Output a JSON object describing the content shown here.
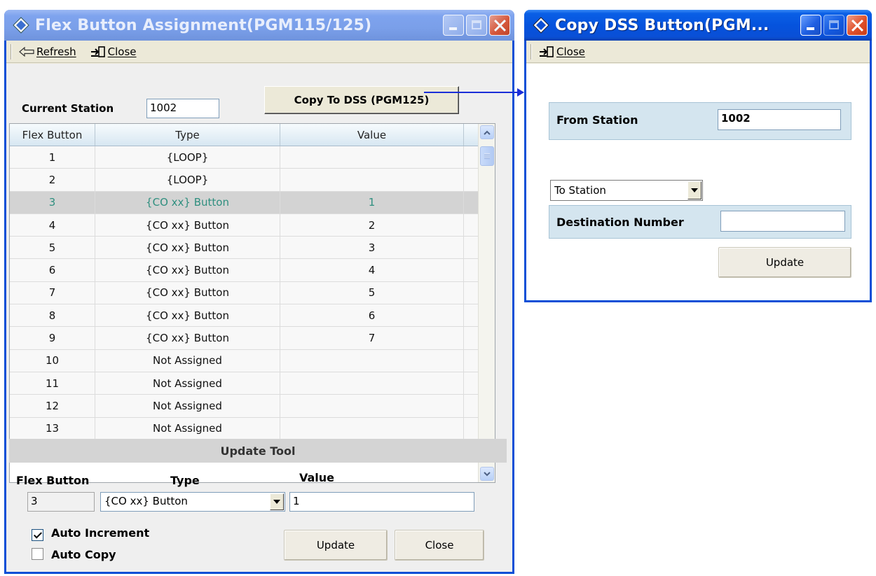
{
  "flex_window": {
    "title": "Flex Button Assignment(PGM115/125)",
    "toolbar": {
      "refresh_label": "Refresh",
      "close_label": "Close"
    },
    "current_station_label": "Current Station",
    "current_station_value": "1002",
    "copy_button_label": "Copy To DSS (PGM125)",
    "grid": {
      "headers": [
        "Flex Button",
        "Type",
        "Value"
      ],
      "rows": [
        {
          "flex": "1",
          "type": "{LOOP}",
          "value": ""
        },
        {
          "flex": "2",
          "type": "{LOOP}",
          "value": ""
        },
        {
          "flex": "3",
          "type": "{CO xx} Button",
          "value": "1"
        },
        {
          "flex": "4",
          "type": "{CO xx} Button",
          "value": "2"
        },
        {
          "flex": "5",
          "type": "{CO xx} Button",
          "value": "3"
        },
        {
          "flex": "6",
          "type": "{CO xx} Button",
          "value": "4"
        },
        {
          "flex": "7",
          "type": "{CO xx} Button",
          "value": "5"
        },
        {
          "flex": "8",
          "type": "{CO xx} Button",
          "value": "6"
        },
        {
          "flex": "9",
          "type": "{CO xx} Button",
          "value": "7"
        },
        {
          "flex": "10",
          "type": "Not Assigned",
          "value": ""
        },
        {
          "flex": "11",
          "type": "Not Assigned",
          "value": ""
        },
        {
          "flex": "12",
          "type": "Not Assigned",
          "value": ""
        },
        {
          "flex": "13",
          "type": "Not Assigned",
          "value": ""
        }
      ],
      "selected_row": "3"
    },
    "update_tool": {
      "title": "Update Tool",
      "flex_label": "Flex Button",
      "type_label": "Type",
      "value_label": "Value",
      "flex_value": "3",
      "type_value": "{CO xx} Button",
      "value_value": "1",
      "auto_increment_label": "Auto Increment",
      "auto_copy_label": "Auto Copy",
      "auto_increment_checked": true,
      "auto_copy_checked": false,
      "update_label": "Update",
      "close_label": "Close"
    }
  },
  "dss_window": {
    "title": "Copy DSS Button(PGM...",
    "toolbar": {
      "close_label": "Close"
    },
    "from_station_label": "From Station",
    "from_station_value": "1002",
    "to_select_value": "To Station",
    "destination_label": "Destination Number",
    "destination_value": "",
    "update_label": "Update"
  },
  "colors": {
    "titlebar_active": "#0a4fd6",
    "titlebar_inactive": "#7ea3ee",
    "selection_text": "#2f8f7f",
    "arrow": "#1a2ed8"
  }
}
